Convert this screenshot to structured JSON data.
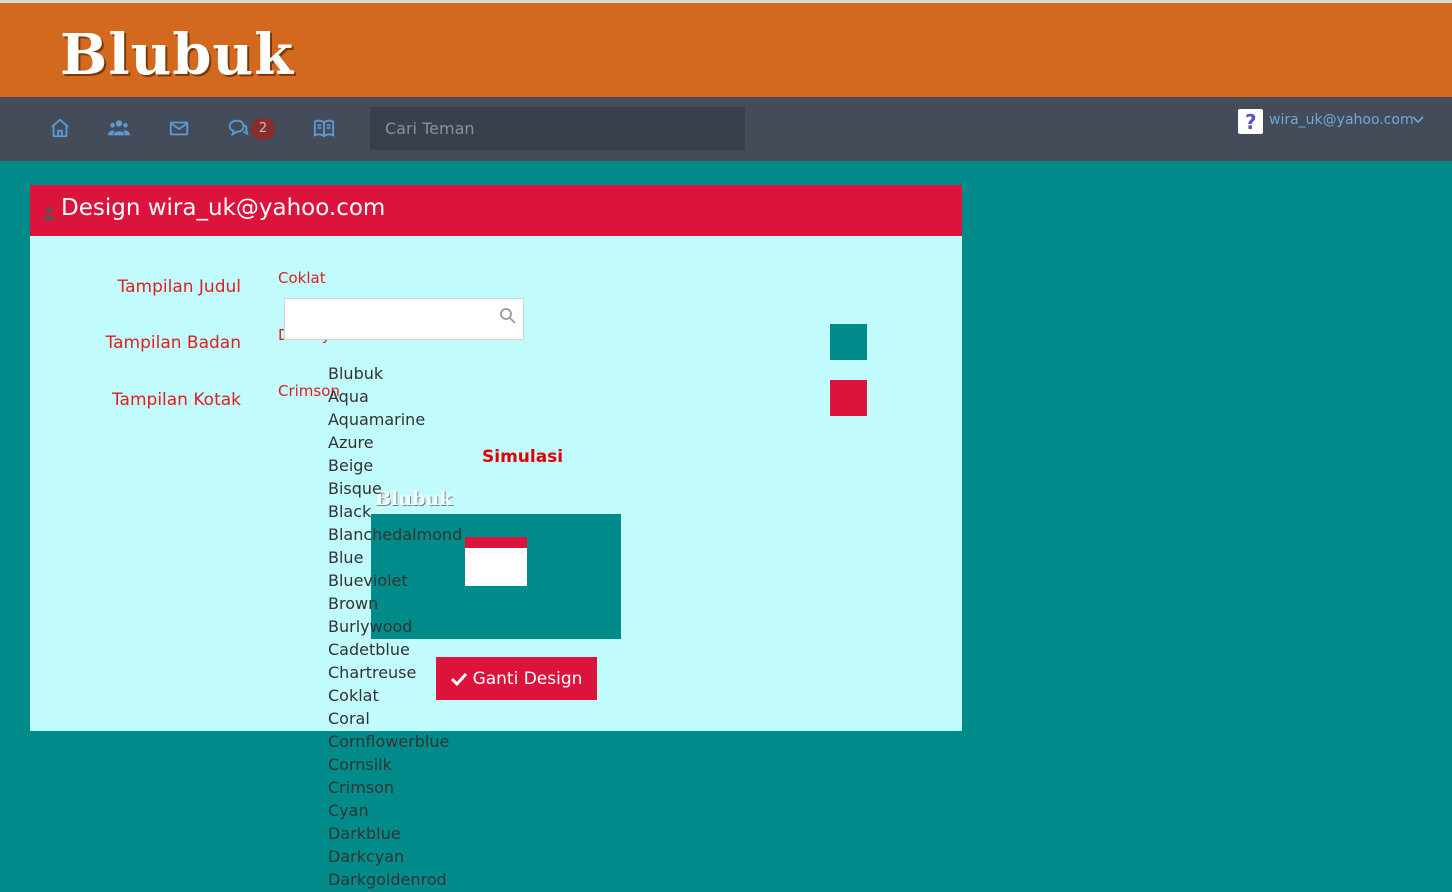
{
  "app": {
    "logo": "Blubuk"
  },
  "nav": {
    "icons": [
      "home-icon",
      "users-icon",
      "mail-icon",
      "chat-icon",
      "book-icon"
    ],
    "chat_badge": "2",
    "search_placeholder": "Cari Teman",
    "user_email": "wira_uk@yahoo.com"
  },
  "panel": {
    "title": "Design wira_uk@yahoo.com",
    "rows": [
      {
        "label": "Tampilan Judul",
        "value": "Coklat"
      },
      {
        "label": "Tampilan Badan",
        "value": "Darkcyan",
        "swatch_color": "#008b8b"
      },
      {
        "label": "Tampilan Kotak",
        "value": "Crimson",
        "swatch_color": "#dc143c"
      }
    ],
    "simulation_title": "Simulasi",
    "simulation_logo": "Blubuk",
    "submit_label": "Ganti Design"
  },
  "dropdown": {
    "options": [
      "Blubuk",
      "Aqua",
      "Aquamarine",
      "Azure",
      "Beige",
      "Bisque",
      "Black",
      "Blanchedalmond",
      "Blue",
      "Blueviolet",
      "Brown",
      "Burlywood",
      "Cadetblue",
      "Chartreuse",
      "Coklat",
      "Coral",
      "Cornflowerblue",
      "Cornsilk",
      "Crimson",
      "Cyan",
      "Darkblue",
      "Darkcyan",
      "Darkgoldenrod"
    ]
  },
  "colors": {
    "header": "#d2691e",
    "navbar": "#444c5a",
    "page_bg": "#008b8b",
    "panel_bg": "#c1fbfb",
    "accent": "#dc143c"
  }
}
